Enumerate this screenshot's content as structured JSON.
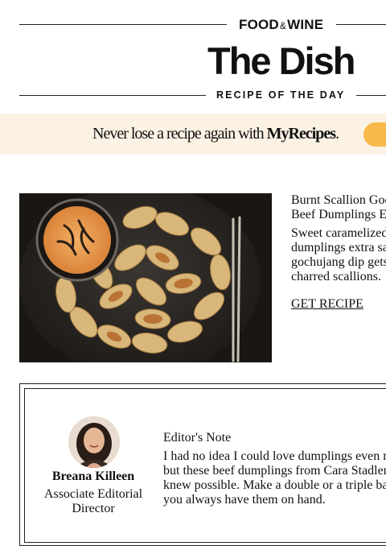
{
  "masthead": {
    "brand_left": "FOOD",
    "brand_amp": "&",
    "brand_right": "WINE",
    "title": "The Dish",
    "subtitle": "RECIPE OF THE DAY"
  },
  "promo": {
    "text_lead": "Never lose a recipe again with ",
    "text_brand": "MyRecipes",
    "text_end": ".",
    "background_color": "#fbf2e4",
    "button_color": "#f7b94a"
  },
  "recipe": {
    "image_icon": "dumplings-photo",
    "name": "Burnt Scallion Goc\nBeef Dumplings E",
    "description": "Sweet caramelized\ndumplings extra sa\ngochujang dip gets\ncharred scallions.",
    "link_label": "GET RECIPE"
  },
  "editor_note": {
    "avatar_icon": "author-avatar",
    "author_name": "Breana Killeen",
    "author_role": "Associate Editorial\nDirector",
    "heading": "Editor's Note",
    "body": "I had no idea I could love dumplings even m\nbut these beef dumplings from Cara Stadler\nknew possible. Make a double or a triple ba\nyou always have them on hand."
  }
}
